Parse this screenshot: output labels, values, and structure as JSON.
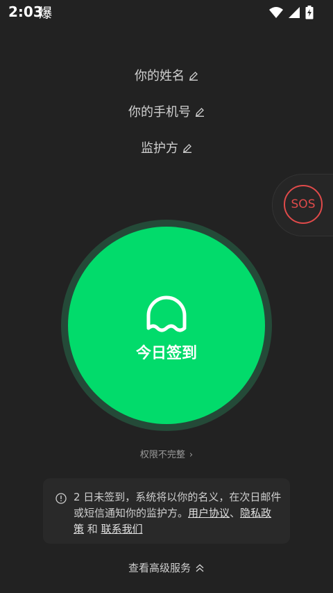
{
  "status_bar": {
    "time": "2:03",
    "notification_glyph": "爆",
    "icons": [
      "wifi-icon",
      "signal-icon",
      "battery-charging-icon"
    ]
  },
  "fields": {
    "name": "你的姓名",
    "phone": "你的手机号",
    "guardian": "监护方"
  },
  "sos": {
    "label": "SOS"
  },
  "checkin": {
    "label": "今日签到",
    "icon": "ghost-icon"
  },
  "permission": {
    "label": "权限不完整",
    "chevron": "›"
  },
  "notice": {
    "text_before": "2 日未签到，系统将以你的名义，在次日邮件或短信通知你的监护方。",
    "user_agreement": "用户协议",
    "sep1": "、",
    "privacy_policy": "隐私政策",
    "sep2": " 和 ",
    "contact_us": "联系我们"
  },
  "advanced": {
    "label": "查看高级服务"
  },
  "colors": {
    "background": "#222222",
    "accent": "#02db6b",
    "sos": "#e04a4a"
  }
}
